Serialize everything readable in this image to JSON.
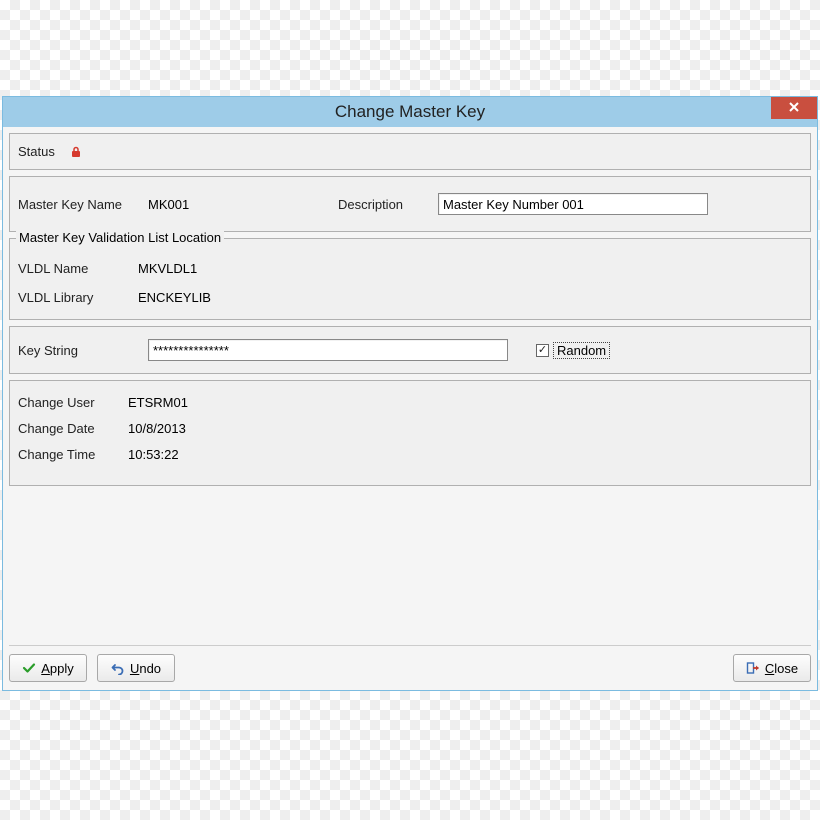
{
  "window": {
    "title": "Change Master Key"
  },
  "status": {
    "label": "Status",
    "locked": true
  },
  "master": {
    "name_label": "Master Key Name",
    "name_value": "MK001",
    "desc_label": "Description",
    "desc_value": "Master Key Number 001"
  },
  "vldl": {
    "legend": "Master Key Validation List Location",
    "name_label": "VLDL Name",
    "name_value": "MKVLDL1",
    "library_label": "VLDL Library",
    "library_value": "ENCKEYLIB"
  },
  "keystring": {
    "label": "Key String",
    "value": "***************",
    "random_label": "Random",
    "random_checked": true
  },
  "change": {
    "user_label": "Change User",
    "user_value": "ETSRM01",
    "date_label": "Change Date",
    "date_value": "10/8/2013",
    "time_label": "Change Time",
    "time_value": "10:53:22"
  },
  "buttons": {
    "apply": "Apply",
    "undo": "Undo",
    "close": "Close"
  }
}
